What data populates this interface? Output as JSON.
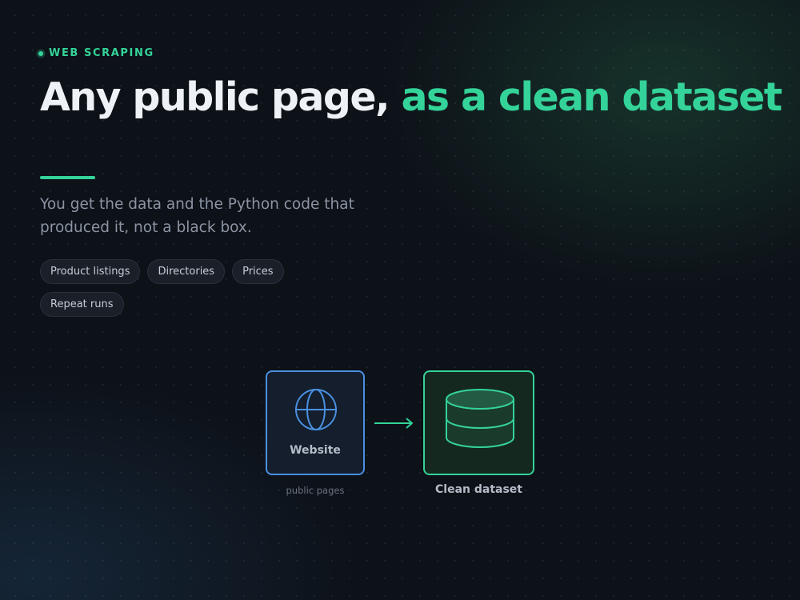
{
  "hero": {
    "eyebrow": "WEB SCRAPING",
    "headline_part1": "Any public page, ",
    "headline_accent": "as a clean dataset",
    "subtitle": "You get the data and the Python code that produced it, not a black box.",
    "tags": [
      "Product listings",
      "Directories",
      "Prices",
      "Repeat runs"
    ]
  },
  "diagram": {
    "source": {
      "label": "Website",
      "caption": "public pages",
      "icon": "globe-icon",
      "color": "#4a90e2"
    },
    "target": {
      "label": "Clean dataset",
      "icon": "database-icon",
      "color": "#34d399"
    },
    "connector_icon": "arrow-right-icon"
  },
  "colors": {
    "background": "#0d1118",
    "accent": "#34d399",
    "source_accent": "#4a90e2",
    "muted_text": "#8b94a3"
  }
}
